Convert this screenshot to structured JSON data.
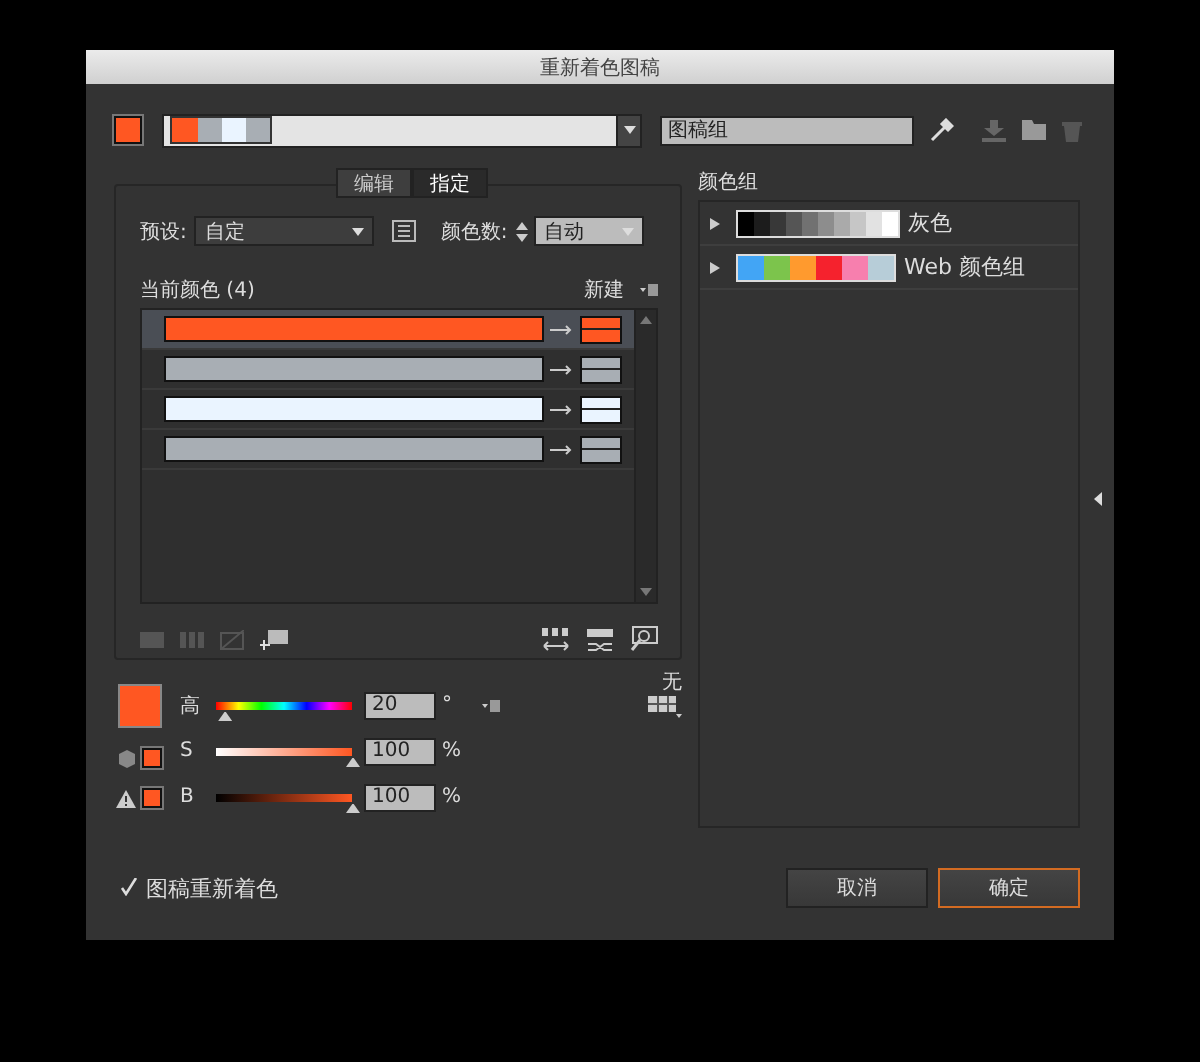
{
  "window": {
    "title": "重新着色图稿"
  },
  "current_color": {
    "color": "#ff5722"
  },
  "color_bar": {
    "swatches": [
      {
        "color": "#ff5722"
      },
      {
        "color": "#a8aeb4"
      },
      {
        "color": "#eaf4ff"
      },
      {
        "color": "#a8aeb4"
      }
    ]
  },
  "group_name": {
    "value": "图稿组"
  },
  "tabs": [
    {
      "label": "编辑",
      "selected": false
    },
    {
      "label": "指定",
      "selected": true
    }
  ],
  "preset": {
    "label": "预设:",
    "value": "自定"
  },
  "color_count": {
    "label": "颜色数:",
    "value": "自动"
  },
  "current_colors": {
    "label": "当前颜色 (4)",
    "new_label": "新建",
    "rows": [
      {
        "color": "#ff5722",
        "new_swatch": {
          "color": "#ff5722"
        },
        "selected": true
      },
      {
        "color": "#a8aeb4",
        "new_swatch": {
          "color": "#a8aeb4"
        },
        "selected": false
      },
      {
        "color": "#eaf4ff",
        "new_swatch": {
          "color": "#eaf4ff"
        },
        "selected": false
      },
      {
        "color": "#a8aeb4",
        "new_swatch": {
          "color": "#a8aeb4"
        },
        "selected": false
      }
    ]
  },
  "hsb": {
    "color": "#ff5722",
    "none_label": "无",
    "sliders": [
      {
        "kind": "hue",
        "label": "高",
        "value": "20",
        "unit": "°",
        "level": 0.06
      },
      {
        "kind": "saturation",
        "label": "S",
        "value": "100",
        "unit": "%",
        "level": 1
      },
      {
        "kind": "brightness",
        "label": "B",
        "value": "100",
        "unit": "%",
        "level": 1
      }
    ]
  },
  "color_groups": {
    "label": "颜色组",
    "items": [
      {
        "name": "灰色",
        "swatches": [
          {
            "color": "#000000"
          },
          {
            "color": "#1c1c1c"
          },
          {
            "color": "#383838"
          },
          {
            "color": "#555555"
          },
          {
            "color": "#717171"
          },
          {
            "color": "#8d8d8d"
          },
          {
            "color": "#aaaaaa"
          },
          {
            "color": "#c6c6c6"
          },
          {
            "color": "#e2e2e2"
          },
          {
            "color": "#ffffff"
          }
        ]
      },
      {
        "name": "Web 颜色组",
        "swatches": [
          {
            "color": "#42a5f5"
          },
          {
            "color": "#7cc44c"
          },
          {
            "color": "#ff9a2e"
          },
          {
            "color": "#f5222d"
          },
          {
            "color": "#f77fae"
          },
          {
            "color": "#b7cdd8"
          }
        ]
      }
    ]
  },
  "recolor_checkbox": {
    "label": "图稿重新着色",
    "checked": true
  },
  "buttons": [
    {
      "label": "取消",
      "default": false
    },
    {
      "label": "确定",
      "default": true
    }
  ]
}
